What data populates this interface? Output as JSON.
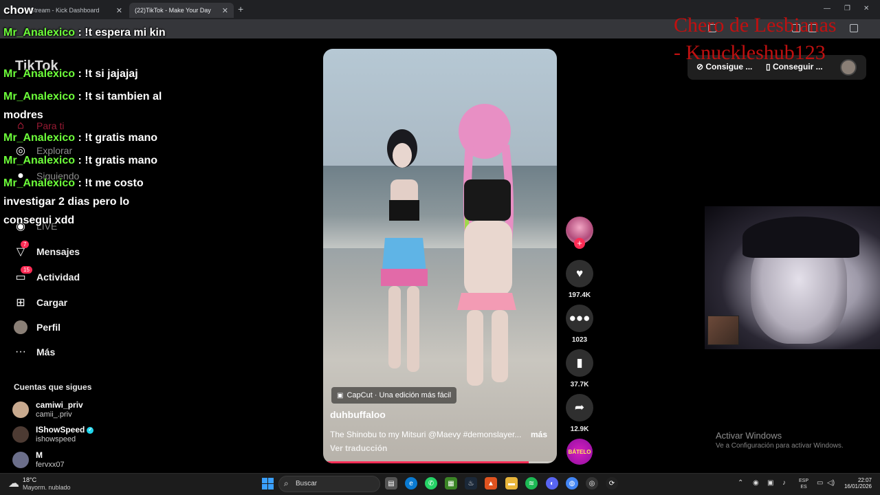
{
  "browser": {
    "tabs": [
      {
        "title": "Stream - Kick Dashboard"
      },
      {
        "title": "(22)TikTok - Make Your Day"
      }
    ],
    "new_tab": "+",
    "close": "✕",
    "window_controls": [
      "—",
      "❐",
      "✕"
    ]
  },
  "stream": {
    "streamer_name": "chow",
    "overlay_line1": "Chero de Lesbianas",
    "overlay_line2": "- Knuckleshub123"
  },
  "chat": [
    {
      "user": "Mr_Analexico",
      "text": " : !t espera mi kin"
    },
    {
      "user": "Mr_Analexico",
      "text": " : !t si jajajaj"
    },
    {
      "user": "Mr_Analexico",
      "text": " : !t si tambien al modres"
    },
    {
      "user": "Mr_Analexico",
      "text": " : !t gratis mano"
    },
    {
      "user": "Mr_Analexico",
      "text": " : !t gratis mano"
    },
    {
      "user": "Mr_Analexico",
      "text": " : !t me costo investigar 2 dias pero lo consegui xdd"
    }
  ],
  "tiktok": {
    "logo": "TikTok",
    "nav": [
      {
        "label": "Para ti",
        "icon": "home-icon"
      },
      {
        "label": "Explorar",
        "icon": "compass-icon"
      },
      {
        "label": "Siguiendo",
        "icon": "following-icon"
      },
      {
        "label": "LIVE",
        "icon": "live-icon"
      },
      {
        "label": "Mensajes",
        "icon": "messages-icon",
        "badge": "7"
      },
      {
        "label": "Actividad",
        "icon": "activity-icon",
        "badge": "15"
      },
      {
        "label": "Cargar",
        "icon": "upload-icon"
      },
      {
        "label": "Perfil",
        "icon": "profile-icon"
      },
      {
        "label": "Más",
        "icon": "more-icon"
      }
    ],
    "following_title": "Cuentas que sigues",
    "following": [
      {
        "name": "camiwi_priv",
        "handle": "camii_.priv",
        "verified": false
      },
      {
        "name": "IShowSpeed",
        "handle": "ishowspeed",
        "verified": true
      },
      {
        "name": "M",
        "handle": "fervxx07",
        "verified": false
      }
    ],
    "video": {
      "capcut": "CapCut · Una edición más fácil",
      "username": "duhbuffaloo",
      "description": "The Shinobu to my Mitsuri @Maevy #demonslayer...",
      "more": "más",
      "translate": "Ver traducción",
      "progress": 0.88
    },
    "actions": {
      "likes": "197.4K",
      "comments": "1023",
      "saves": "37.7K",
      "shares": "12.9K",
      "sound_label": "BÁTELO"
    },
    "header_pills": [
      "Consigue ...",
      "Conseguir ..."
    ]
  },
  "windows": {
    "activate_title": "Activar Windows",
    "activate_sub": "Ve a Configuración para activar Windows."
  },
  "taskbar": {
    "weather_temp": "18°C",
    "weather_desc": "Mayorm. nublado",
    "search": "Buscar",
    "lang_top": "ESP",
    "lang_bottom": "ES",
    "time": "22:07",
    "date": "16/01/2026"
  },
  "colors": {
    "accent": "#fe2c55",
    "chat_user": "#6dff3a",
    "overlay_red": "#c01010"
  }
}
